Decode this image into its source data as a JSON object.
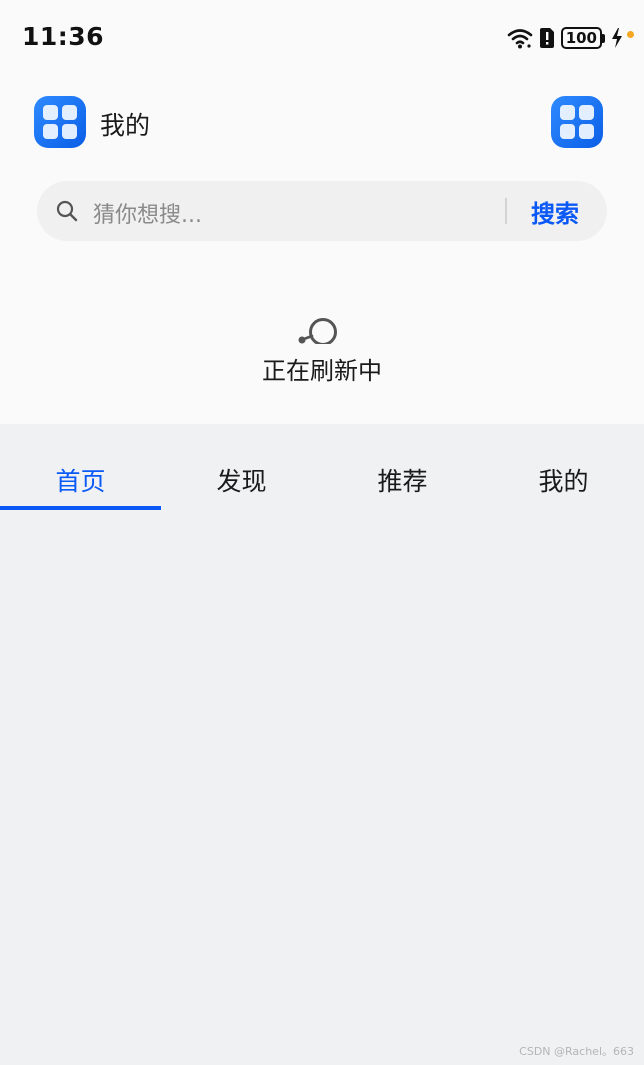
{
  "status_bar": {
    "time": "11:36",
    "battery": "100",
    "icons": [
      "wifi-icon",
      "sim-alert-icon",
      "battery-icon",
      "charging-icon"
    ]
  },
  "header": {
    "title": "我的",
    "left_icon": "app-grid-icon",
    "right_icon": "app-grid-icon"
  },
  "search": {
    "placeholder": "猜你想搜...",
    "button_label": "搜索"
  },
  "refresh": {
    "text": "正在刷新中"
  },
  "tabs": [
    {
      "label": "首页",
      "active": true
    },
    {
      "label": "发现",
      "active": false
    },
    {
      "label": "推荐",
      "active": false
    },
    {
      "label": "我的",
      "active": false
    }
  ],
  "colors": {
    "accent": "#0a59f7",
    "top_background": "#fafafa",
    "content_background": "#eff1f3"
  },
  "watermark": "CSDN @Rachel。663"
}
